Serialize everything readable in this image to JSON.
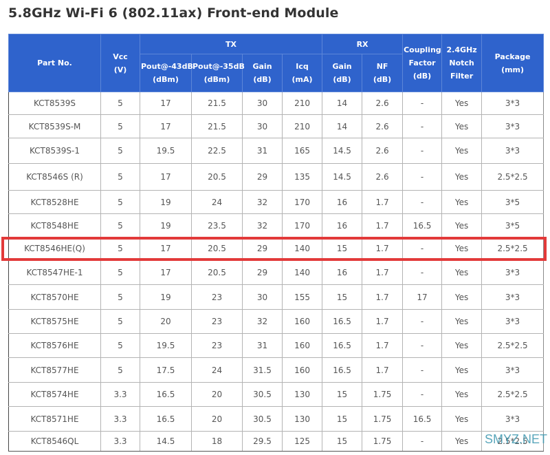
{
  "title": "5.8GHz Wi-Fi 6 (802.11ax) Front-end Module",
  "header": {
    "part_no": "Part No.",
    "vcc": [
      "Vcc",
      "(V)"
    ],
    "tx_group": "TX",
    "rx_group": "RX",
    "tx_cols": [
      [
        "Pout@-43dB",
        "(dBm)"
      ],
      [
        "Pout@-35dB",
        "(dBm)"
      ],
      [
        "Gain",
        "(dB)"
      ],
      [
        "Icq",
        "(mA)"
      ]
    ],
    "rx_cols": [
      [
        "Gain",
        "(dB)"
      ],
      [
        "NF",
        "(dB)"
      ]
    ],
    "coupling": [
      "Coupling",
      "Factor",
      "(dB)"
    ],
    "notch": [
      "2.4GHz",
      "Notch",
      "Filter"
    ],
    "package": [
      "Package",
      "(mm)"
    ]
  },
  "rows": [
    [
      "KCT8539S",
      "5",
      "17",
      "21.5",
      "30",
      "210",
      "14",
      "2.6",
      "-",
      "Yes",
      "3*3"
    ],
    [
      "KCT8539S-M",
      "5",
      "17",
      "21.5",
      "30",
      "210",
      "14",
      "2.6",
      "-",
      "Yes",
      "3*3"
    ],
    [
      "KCT8539S-1",
      "5",
      "19.5",
      "22.5",
      "31",
      "165",
      "14.5",
      "2.6",
      "-",
      "Yes",
      "3*3"
    ],
    [
      "KCT8546S (R)",
      "5",
      "17",
      "20.5",
      "29",
      "135",
      "14.5",
      "2.6",
      "-",
      "Yes",
      "2.5*2.5"
    ],
    [
      "KCT8528HE",
      "5",
      "19",
      "24",
      "32",
      "170",
      "16",
      "1.7",
      "-",
      "Yes",
      "3*5"
    ],
    [
      "KCT8548HE",
      "5",
      "19",
      "23.5",
      "32",
      "170",
      "16",
      "1.7",
      "16.5",
      "Yes",
      "3*5"
    ],
    [
      "KCT8546HE(Q)",
      "5",
      "17",
      "20.5",
      "29",
      "140",
      "15",
      "1.7",
      "-",
      "Yes",
      "2.5*2.5"
    ],
    [
      "KCT8547HE-1",
      "5",
      "17",
      "20.5",
      "29",
      "140",
      "16",
      "1.7",
      "-",
      "Yes",
      "3*3"
    ],
    [
      "KCT8570HE",
      "5",
      "19",
      "23",
      "30",
      "155",
      "15",
      "1.7",
      "17",
      "Yes",
      "3*3"
    ],
    [
      "KCT8575HE",
      "5",
      "20",
      "23",
      "32",
      "160",
      "16.5",
      "1.7",
      "-",
      "Yes",
      "3*3"
    ],
    [
      "KCT8576HE",
      "5",
      "19.5",
      "23",
      "31",
      "160",
      "16.5",
      "1.7",
      "-",
      "Yes",
      "2.5*2.5"
    ],
    [
      "KCT8577HE",
      "5",
      "17.5",
      "24",
      "31.5",
      "160",
      "16.5",
      "1.7",
      "-",
      "Yes",
      "3*3"
    ],
    [
      "KCT8574HE",
      "3.3",
      "16.5",
      "20",
      "30.5",
      "130",
      "15",
      "1.75",
      "-",
      "Yes",
      "2.5*2.5"
    ],
    [
      "KCT8571HE",
      "3.3",
      "16.5",
      "20",
      "30.5",
      "130",
      "15",
      "1.75",
      "16.5",
      "Yes",
      "3*3"
    ],
    [
      "KCT8546QL",
      "3.3",
      "14.5",
      "18",
      "29.5",
      "125",
      "15",
      "1.75",
      "-",
      "Yes",
      "2.5*2.5"
    ]
  ],
  "highlighted_row": "KCT8546HE(Q)",
  "highlight_color": "#e23a3a",
  "header_color": "#2f63cc",
  "watermark": "SMYZ.NET"
}
